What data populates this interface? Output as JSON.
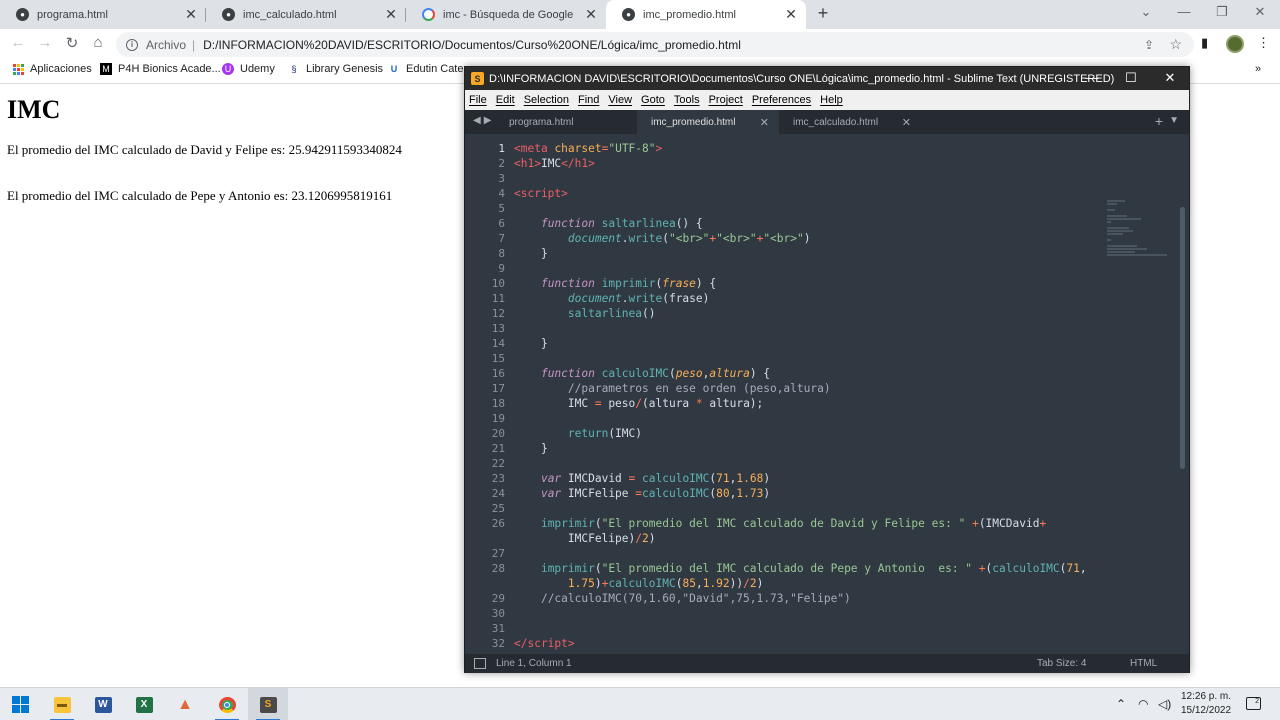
{
  "browser": {
    "tabs": [
      {
        "label": "programa.html",
        "active": false
      },
      {
        "label": "imc_calculado.html",
        "active": false
      },
      {
        "label": "imc - Búsqueda de Google",
        "active": false
      },
      {
        "label": "imc_promedio.html",
        "active": true
      }
    ],
    "omnibox": {
      "security_label": "Archivo",
      "url": "D:/INFORMACION%20DAVID/ESCRITORIO/Documentos/Curso%20ONE/Lógica/imc_promedio.html"
    },
    "bookmarks": [
      {
        "label": "Aplicaciones",
        "icon": "apps-grid-icon"
      },
      {
        "label": "P4H Bionics Acade...",
        "icon": "p4h-icon"
      },
      {
        "label": "Udemy",
        "icon": "udemy-icon"
      },
      {
        "label": "Library Genesis",
        "icon": "libgen-icon"
      },
      {
        "label": "Edutin Categ",
        "icon": "edutin-icon"
      }
    ]
  },
  "page": {
    "heading": "IMC",
    "line1": "El promedio del IMC calculado de David y Felipe es: 25.942911593340824",
    "line2": "El promedio del IMC calculado de Pepe y Antonio es: 23.1206995819161"
  },
  "sublime": {
    "title": "D:\\INFORMACION DAVID\\ESCRITORIO\\Documentos\\Curso ONE\\Lógica\\imc_promedio.html - Sublime Text (UNREGISTERED)",
    "menu": [
      "File",
      "Edit",
      "Selection",
      "Find",
      "View",
      "Goto",
      "Tools",
      "Project",
      "Preferences",
      "Help"
    ],
    "tabs": [
      {
        "label": "programa.html",
        "active": false
      },
      {
        "label": "imc_promedio.html",
        "active": true
      },
      {
        "label": "imc_calculado.html",
        "active": false
      }
    ],
    "line_numbers": [
      "1",
      "2",
      "3",
      "4",
      "5",
      "6",
      "7",
      "8",
      "9",
      "10",
      "11",
      "12",
      "13",
      "14",
      "15",
      "16",
      "17",
      "18",
      "19",
      "20",
      "21",
      "22",
      "23",
      "24",
      "25",
      "26",
      "",
      "27",
      "28",
      "",
      "29",
      "30",
      "31",
      "32"
    ],
    "status": {
      "position": "Line 1, Column 1",
      "tab_size": "Tab Size: 4",
      "syntax": "HTML"
    }
  },
  "taskbar": {
    "apps": [
      "windows-start-icon",
      "file-explorer-icon",
      "word-icon",
      "excel-icon",
      "matlab-icon",
      "chrome-icon",
      "sublime-text-icon"
    ],
    "time": "12:26 p. m.",
    "date": "15/12/2022"
  },
  "colors": {
    "editor_bg": "#303841",
    "keyword": "#c695c6",
    "function": "#5fb4b4",
    "string": "#99c794",
    "number": "#f9ae58",
    "tag": "#ec5f66"
  }
}
